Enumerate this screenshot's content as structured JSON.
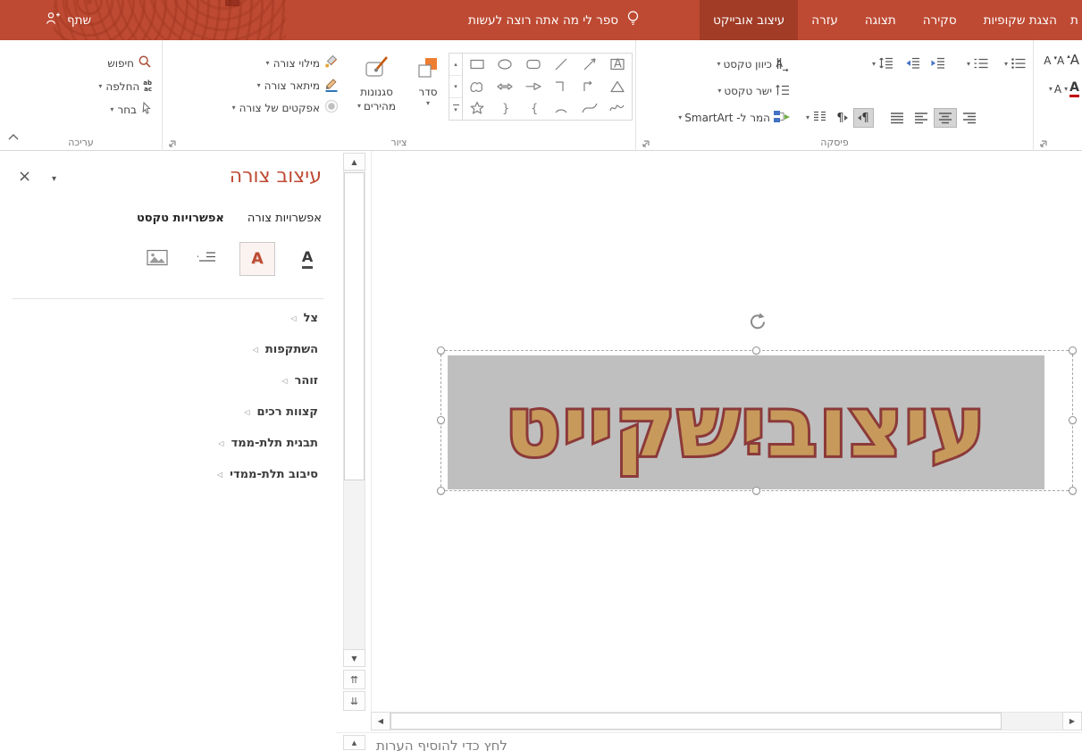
{
  "colors": {
    "titlebar": "#BE4A33",
    "titlebar_active_tab": "#A23C27",
    "accent_red": "#BE4A33",
    "wordart_fill": "#C79A5B",
    "wordart_outline": "#8C3A3A",
    "wordart_background": "#BFBFBF",
    "font_color_swatch": "#C00000"
  },
  "titlebar": {
    "partial_tab": "ת",
    "tabs": [
      {
        "label": "הצגת שקופיות",
        "active": false
      },
      {
        "label": "סקירה",
        "active": false
      },
      {
        "label": "תצוגה",
        "active": false
      },
      {
        "label": "עזרה",
        "active": false
      },
      {
        "label": "עיצוב אובייקט",
        "active": true
      }
    ],
    "tell_me": "ספר לי מה אתה רוצה לעשות",
    "share": "שתף"
  },
  "ribbon": {
    "editing": {
      "label": "עריכה",
      "find": "חיפוש",
      "replace": "החלפה",
      "select": "בחר"
    },
    "drawing": {
      "label": "ציור",
      "shape_fill": "מילוי צורה",
      "shape_outline": "מיתאר צורה",
      "shape_effects": "אפקטים של צורה",
      "quick_styles_line1": "סגנונות",
      "quick_styles_line2": "מהירים",
      "arrange": "סדר"
    },
    "paragraph": {
      "label": "פיסקה",
      "text_direction": "כיוון טקסט",
      "align_text": "ישר טקסט",
      "convert_smartart": "המר ל- SmartArt"
    }
  },
  "pane": {
    "title": "עיצוב צורה",
    "tabs": [
      {
        "label": "אפשרויות צורה",
        "active": false
      },
      {
        "label": "אפשרויות טקסט",
        "active": true
      }
    ],
    "sections": [
      {
        "label": "צל"
      },
      {
        "label": "השתקפות"
      },
      {
        "label": "זוהר"
      },
      {
        "label": "קצוות רכים"
      },
      {
        "label": "תבנית תלת-ממד"
      },
      {
        "label": "סיבוב תלת-ממדי"
      }
    ]
  },
  "slide": {
    "wordart_text": "עיצוביִשקייט"
  },
  "notes": {
    "placeholder": "לחץ כדי להוסיף הערות"
  },
  "icons": {
    "dropdown": "▾",
    "close": "×",
    "pane_menu": "▾",
    "section_collapsed": "◁",
    "scroll_up": "▲",
    "scroll_down": "▼",
    "scroll_left": "◀",
    "scroll_right": "▶",
    "prev_slide": "⇈",
    "next_slide": "⇊",
    "collapse_notes": "▲",
    "pilcrow": "¶",
    "replace_ab": "ab",
    "replace_ac": "ac",
    "letter_a": "A",
    "gallery_up": "▴",
    "gallery_down": "▾",
    "brace_close": "}",
    "brace_open": "{"
  }
}
